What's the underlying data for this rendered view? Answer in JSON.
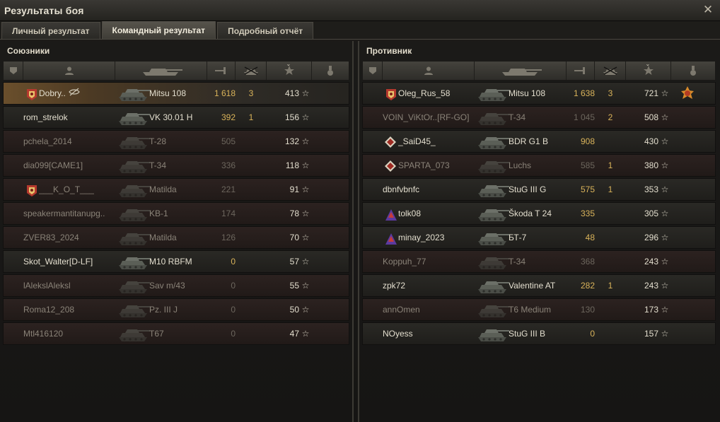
{
  "window": {
    "title": "Результаты боя",
    "close_glyph": "✕"
  },
  "tabs": [
    {
      "label": "Личный результат",
      "active": false
    },
    {
      "label": "Командный результат",
      "active": true
    },
    {
      "label": "Подробный отчёт",
      "active": false
    }
  ],
  "allies": {
    "title": "Союзники",
    "header_icons": [
      "vehicle-status-icon",
      "player-icon",
      "tank-icon",
      "damage-icon",
      "kills-icon",
      "xp-star-icon",
      "medal-icon"
    ],
    "rows": [
      {
        "badge": "clan-emblem",
        "name": "Dobry..",
        "tank": "Mitsu 108",
        "damage": "1 618",
        "kills": "3",
        "xp": "413",
        "star": "☆",
        "state": "player",
        "extra_icon": "hidden-name-icon"
      },
      {
        "badge": "",
        "name": "rom_strelok",
        "tank": "VK 30.01 H",
        "damage": "392",
        "kills": "1",
        "xp": "156",
        "star": "☆",
        "state": "alive"
      },
      {
        "badge": "",
        "name": "pchela_2014",
        "tank": "T-28",
        "damage": "505",
        "kills": "",
        "xp": "132",
        "star": "☆",
        "state": "dead"
      },
      {
        "badge": "",
        "name": "dia099[CAME1]",
        "tank": "T-34",
        "damage": "336",
        "kills": "",
        "xp": "118",
        "star": "☆",
        "state": "dead"
      },
      {
        "badge": "clan-emblem",
        "name": "___K_O_T___",
        "tank": "Matilda",
        "damage": "221",
        "kills": "",
        "xp": "91",
        "star": "☆",
        "state": "dead"
      },
      {
        "badge": "",
        "name": "speakermantitanupg..",
        "tank": "KB-1",
        "damage": "174",
        "kills": "",
        "xp": "78",
        "star": "☆",
        "state": "dead"
      },
      {
        "badge": "",
        "name": "ZVER83_2024",
        "tank": "Matilda",
        "damage": "126",
        "kills": "",
        "xp": "70",
        "star": "☆",
        "state": "dead"
      },
      {
        "badge": "",
        "name": "Skot_Walter[D-LF]",
        "tank": "M10 RBFM",
        "damage": "0",
        "kills": "",
        "xp": "57",
        "star": "☆",
        "state": "alive"
      },
      {
        "badge": "",
        "name": "lAlekslAleksl",
        "tank": "Sav m/43",
        "damage": "0",
        "kills": "",
        "xp": "55",
        "star": "☆",
        "state": "dead"
      },
      {
        "badge": "",
        "name": "Roma12_208",
        "tank": "Pz. III J",
        "damage": "0",
        "kills": "",
        "xp": "50",
        "star": "☆",
        "state": "dead"
      },
      {
        "badge": "",
        "name": "Mtl416120",
        "tank": "T67",
        "damage": "0",
        "kills": "",
        "xp": "47",
        "star": "☆",
        "state": "dead"
      }
    ]
  },
  "enemies": {
    "title": "Противник",
    "header_icons": [
      "vehicle-status-icon",
      "player-icon",
      "tank-icon",
      "damage-icon",
      "kills-icon",
      "xp-star-icon",
      "medal-icon"
    ],
    "rows": [
      {
        "badge": "clan-emblem",
        "name": "Oleg_Rus_58",
        "tank": "Mitsu 108",
        "damage": "1 638",
        "kills": "3",
        "xp": "721",
        "star": "☆",
        "state": "alive",
        "medal": "order-medal"
      },
      {
        "badge": "",
        "name": "VOIN_ViKtOr..[RF-GO]",
        "tank": "T-34",
        "damage": "1 045",
        "kills": "2",
        "xp": "508",
        "star": "☆",
        "state": "dead"
      },
      {
        "badge": "rank-emblem",
        "name": "_SaiD45_",
        "tank": "BDR G1 B",
        "damage": "908",
        "kills": "",
        "xp": "430",
        "star": "☆",
        "state": "alive"
      },
      {
        "badge": "rank-emblem",
        "name": "SPARTA_073",
        "tank": "Luchs",
        "damage": "585",
        "kills": "1",
        "xp": "380",
        "star": "☆",
        "state": "dead"
      },
      {
        "badge": "",
        "name": "dbnfvbnfc",
        "tank": "StuG III G",
        "damage": "575",
        "kills": "1",
        "xp": "353",
        "star": "☆",
        "state": "alive"
      },
      {
        "badge": "clan-flag",
        "name": "tolk08",
        "tank": "Škoda T 24",
        "damage": "335",
        "kills": "",
        "xp": "305",
        "star": "☆",
        "state": "alive"
      },
      {
        "badge": "clan-flag",
        "name": "minay_2023",
        "tank": "БТ-7",
        "damage": "48",
        "kills": "",
        "xp": "296",
        "star": "☆",
        "state": "alive"
      },
      {
        "badge": "",
        "name": "Koppuh_77",
        "tank": "T-34",
        "damage": "368",
        "kills": "",
        "xp": "243",
        "star": "☆",
        "state": "dead"
      },
      {
        "badge": "",
        "name": "zpk72",
        "tank": "Valentine AT",
        "damage": "282",
        "kills": "1",
        "xp": "243",
        "star": "☆",
        "state": "alive"
      },
      {
        "badge": "",
        "name": "annOmen",
        "tank": "T6 Medium",
        "damage": "130",
        "kills": "",
        "xp": "173",
        "star": "☆",
        "state": "dead"
      },
      {
        "badge": "",
        "name": "NOyess",
        "tank": "StuG III B",
        "damage": "0",
        "kills": "",
        "xp": "157",
        "star": "☆",
        "state": "alive"
      }
    ]
  },
  "colors": {
    "accent": "#d9b35a",
    "dead_text": "#8a8378",
    "alive_text": "#e3dece"
  }
}
